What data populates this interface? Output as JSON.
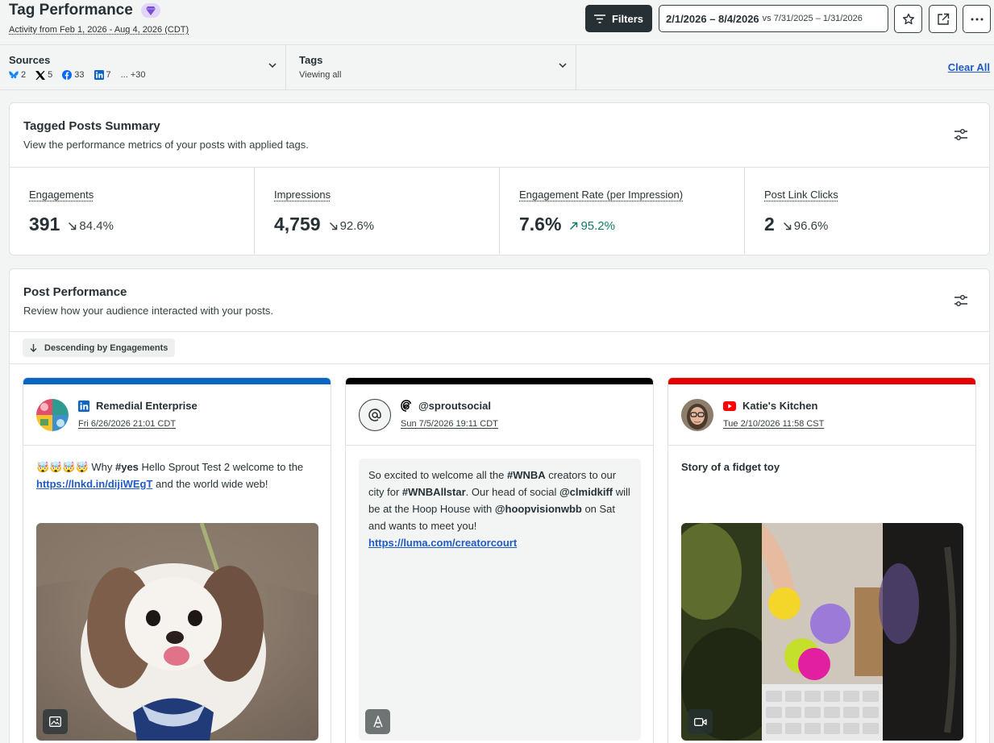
{
  "header": {
    "title": "Tag Performance",
    "activity_range": "Activity from Feb 1, 2026 - Aug 4, 2026 (CDT)",
    "filters_label": "Filters",
    "date_range": "2/1/2026 – 8/4/2026",
    "compare_range": "vs 7/31/2025 – 1/31/2026",
    "icons": [
      "diamond-icon",
      "filter-icon",
      "star-icon",
      "export-icon",
      "more-icon"
    ]
  },
  "filterbar": {
    "sources_label": "Sources",
    "sources": [
      {
        "network": "bluesky",
        "count": "2"
      },
      {
        "network": "x",
        "count": "5"
      },
      {
        "network": "facebook",
        "count": "33"
      },
      {
        "network": "linkedin",
        "count": "7"
      }
    ],
    "sources_more": "... +30",
    "tags_label": "Tags",
    "tags_value": "Viewing all",
    "clear_all": "Clear All"
  },
  "summary": {
    "title": "Tagged Posts Summary",
    "subtitle": "View the performance metrics of your posts with applied tags.",
    "metrics": [
      {
        "label": "Engagements",
        "value": "391",
        "change": "84.4%",
        "direction": "down"
      },
      {
        "label": "Impressions",
        "value": "4,759",
        "change": "92.6%",
        "direction": "down"
      },
      {
        "label": "Engagement Rate (per Impression)",
        "value": "7.6%",
        "change": "95.2%",
        "direction": "up"
      },
      {
        "label": "Post Link Clicks",
        "value": "2",
        "change": "96.6%",
        "direction": "down"
      }
    ]
  },
  "performance": {
    "title": "Post Performance",
    "subtitle": "Review how your audience interacted with your posts.",
    "sort_label": "Descending by Engagements",
    "posts": [
      {
        "network": "linkedin",
        "bar_color": "#0a66c2",
        "name": "Remedial Enterprise",
        "date": "Fri 6/26/2026 21:01 CDT",
        "text_emoji": "🤯🤯🤯🤯",
        "text_1": " Why ",
        "hashtag": "#yes",
        "text_2": " Hello Sprout Test 2 welcome to the",
        "link": "https://lnkd.in/dijiWEgT",
        "text_3": " and the world wide web!",
        "media_type": "image"
      },
      {
        "network": "threads",
        "bar_color": "#000000",
        "name": "@sproutsocial",
        "date": "Sun 7/5/2026 19:11 CDT",
        "t1": "So excited to welcome all the ",
        "h1": "#WNBA",
        "t2": " creators to our city for ",
        "h2": "#WNBAllstar",
        "t3": ". Our head of social ",
        "h3": "@clmidkiff",
        "t4": " will be at the Hoop House with ",
        "h4": "@hoopvisionwbb",
        "t5": " on Sat and wants to meet you!",
        "link": "https://luma.com/creatorcourt",
        "media_type": "text"
      },
      {
        "network": "youtube",
        "bar_color": "#e60000",
        "name": "Katie's Kitchen",
        "date": "Tue 2/10/2026 11:58 CST",
        "text": "Story of a fidget toy",
        "media_type": "video"
      }
    ]
  }
}
